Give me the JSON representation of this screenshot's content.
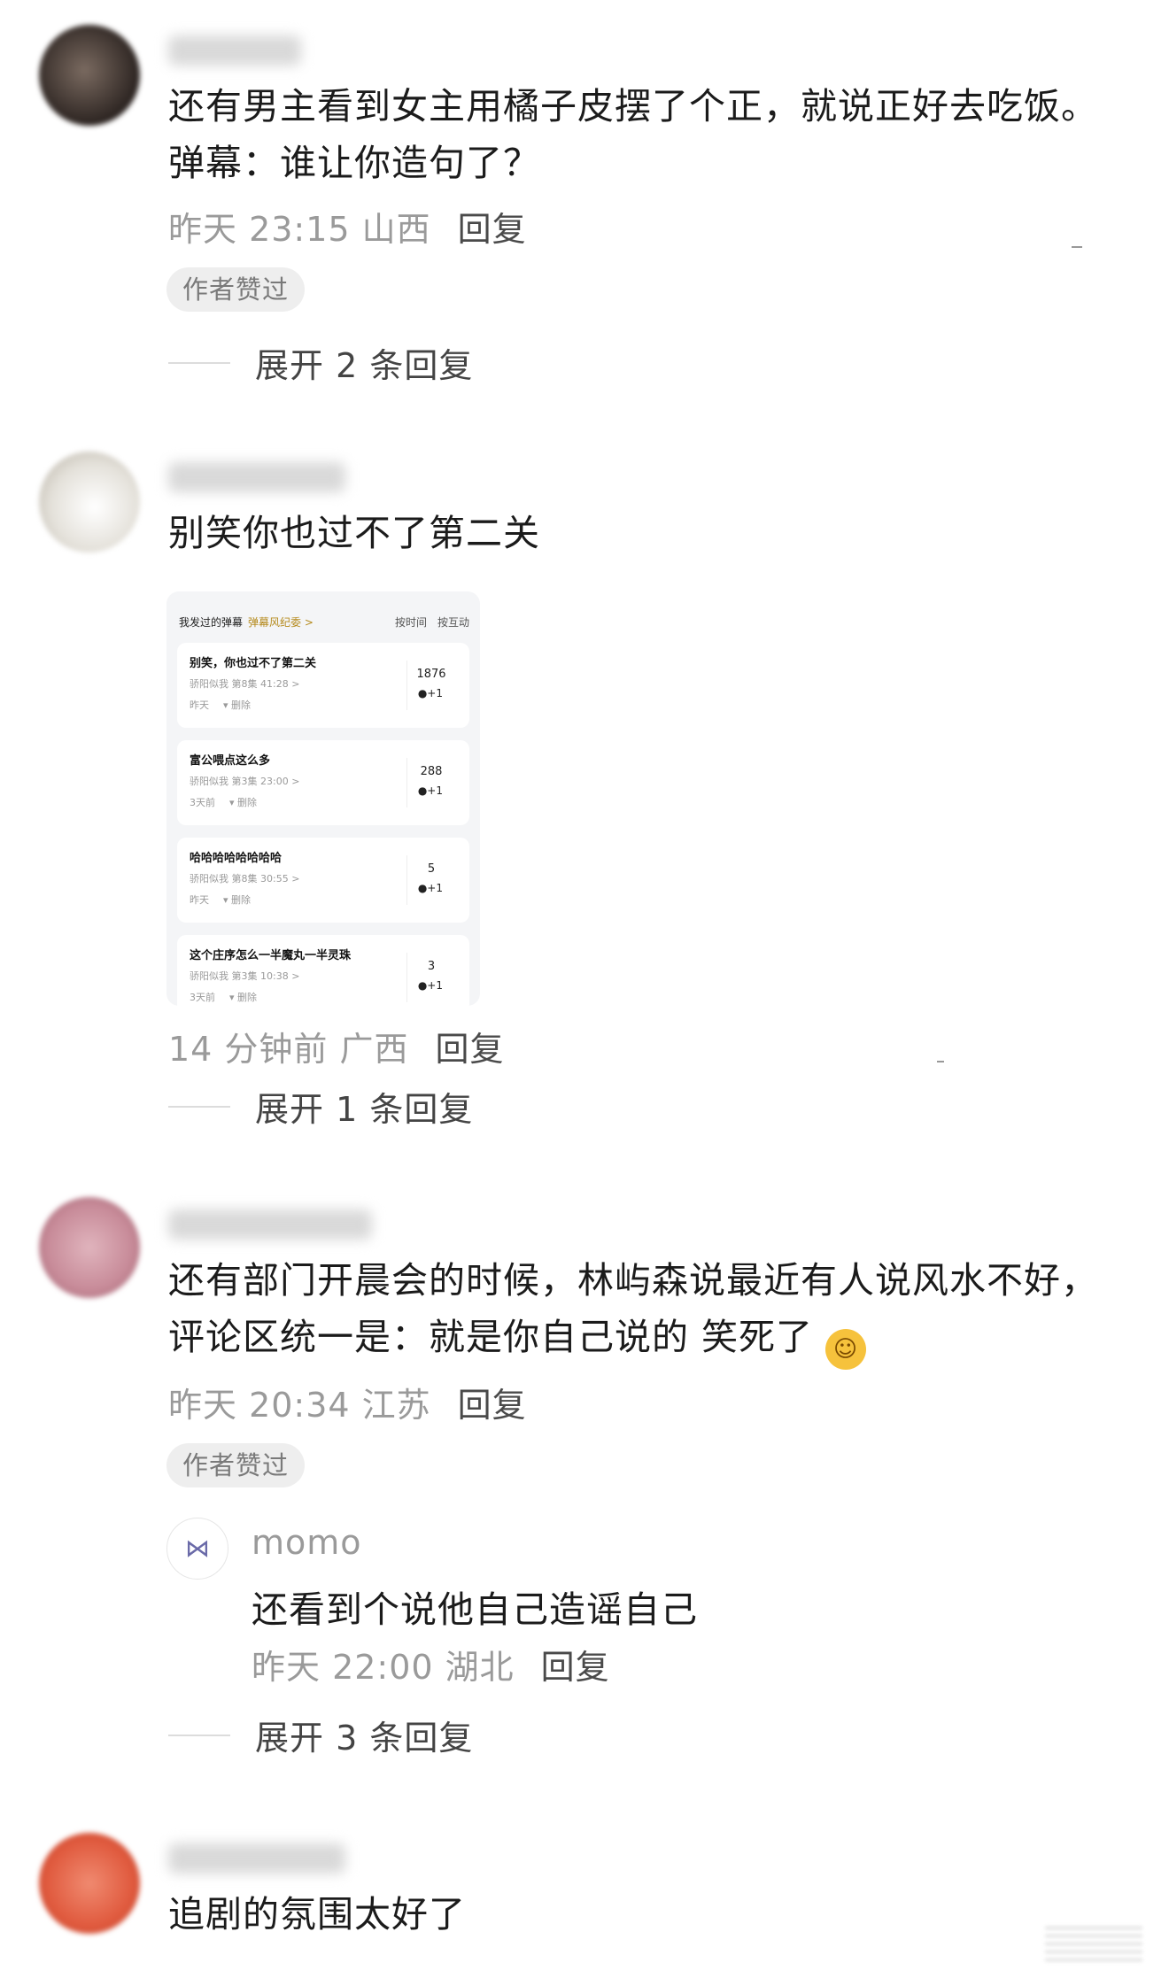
{
  "comments": [
    {
      "text_lines": [
        "还有男主看到女主用橘子皮摆了个正，就说正好去吃饭。",
        "弹幕：谁让你造句了？"
      ],
      "time": "昨天 23:15 山西",
      "reply": "回复",
      "badge": "作者赞过",
      "expand": "展开 2 条回复"
    },
    {
      "text_lines": [
        "别笑你也过不了第二关"
      ],
      "time": "14 分钟前 广西",
      "reply": "回复",
      "expand": "展开 1 条回复",
      "screenshot": {
        "title": "我发过的弹幕",
        "tag": "弹幕风纪委 >",
        "sort_time": "按时间",
        "sort_interaction": "按互动",
        "items": [
          {
            "text": "别笑，你也过不了第二关",
            "source": "骄阳似我 第8集 41:28 >",
            "date": "昨天",
            "delete": "删除",
            "count": "1876"
          },
          {
            "text": "富公喂点这么多",
            "source": "骄阳似我 第3集 23:00 >",
            "date": "3天前",
            "delete": "删除",
            "count": "288"
          },
          {
            "text": "哈哈哈哈哈哈哈哈",
            "source": "骄阳似我 第8集 30:55 >",
            "date": "昨天",
            "delete": "删除",
            "count": "5"
          },
          {
            "text": "这个庄序怎么一半魔丸一半灵珠",
            "source": "骄阳似我 第3集 10:38 >",
            "date": "3天前",
            "delete": "删除",
            "count": "3"
          }
        ],
        "plus_label": "+1"
      }
    },
    {
      "text_lines": [
        "还有部门开晨会的时候，林屿森说最近有人说风水不好，",
        "评论区统一是：就是你自己说的    笑死了"
      ],
      "time": "昨天 20:34 江苏",
      "reply": "回复",
      "badge": "作者赞过",
      "sub_reply": {
        "name": "momo",
        "text": "还看到个说他自己造谣自己",
        "time": "昨天 22:00 湖北",
        "reply": "回复"
      },
      "expand": "展开 3 条回复"
    },
    {
      "text_lines": [
        "追剧的氛围太好了"
      ]
    }
  ],
  "icons": {
    "laugh_emoji": "tears-of-joy-emoji",
    "bow_avatar": "bow-icon",
    "trash": "trash-icon",
    "person_plus": "person-plus-icon"
  },
  "colors": {
    "text": "#1b1b1b",
    "meta": "#9a9a9a",
    "badge_bg": "#eeeeee",
    "tag": "#b58a1c"
  }
}
